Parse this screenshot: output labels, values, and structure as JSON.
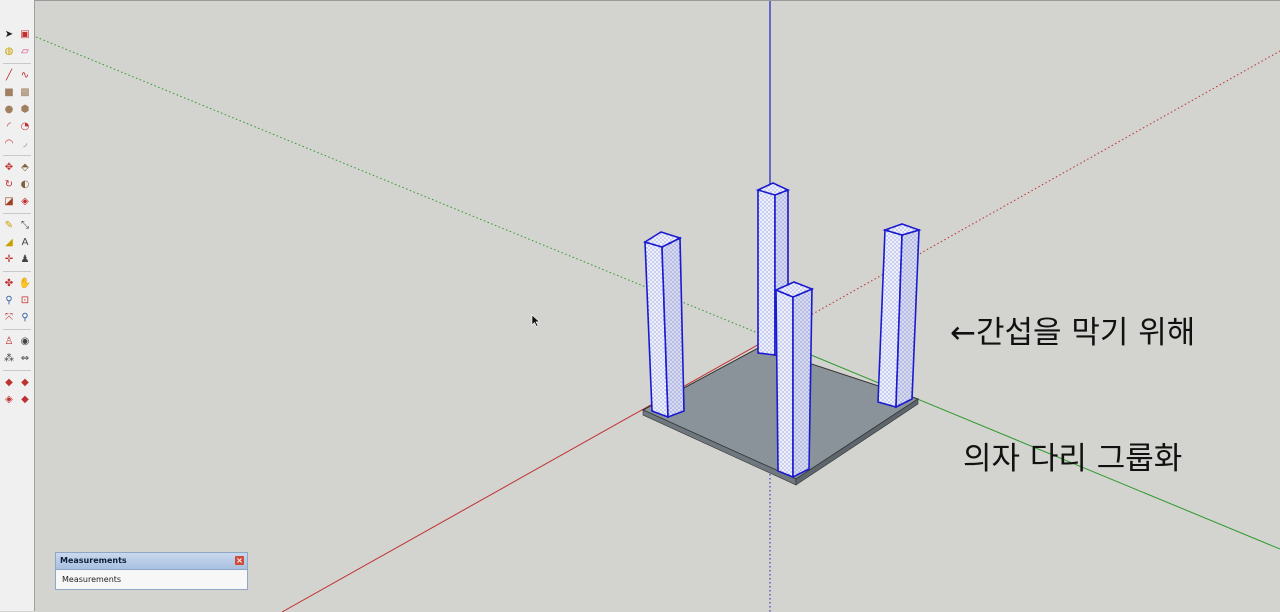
{
  "toolbar": {
    "groups": [
      {
        "tools": [
          {
            "icon": "select-arrow-icon",
            "glyph": "➤",
            "color": "#222"
          },
          {
            "icon": "make-component-icon",
            "glyph": "▣",
            "color": "#c03030"
          },
          {
            "icon": "paint-bucket-icon",
            "glyph": "◍",
            "color": "#c8a000"
          },
          {
            "icon": "eraser-icon",
            "glyph": "▱",
            "color": "#d04080"
          }
        ]
      },
      {
        "tools": [
          {
            "icon": "pencil-line-icon",
            "glyph": "╱",
            "color": "#b03020"
          },
          {
            "icon": "freehand-icon",
            "glyph": "∿",
            "color": "#c03030"
          },
          {
            "icon": "rectangle-icon",
            "glyph": "■",
            "color": "#a08060"
          },
          {
            "icon": "rotated-rectangle-icon",
            "glyph": "▩",
            "color": "#a08060"
          },
          {
            "icon": "circle-icon",
            "glyph": "●",
            "color": "#a08060"
          },
          {
            "icon": "polygon-icon",
            "glyph": "⬢",
            "color": "#a08060"
          },
          {
            "icon": "arc-icon",
            "glyph": "◜",
            "color": "#c03030"
          },
          {
            "icon": "pie-icon",
            "glyph": "◔",
            "color": "#c03030"
          },
          {
            "icon": "three-point-arc-icon",
            "glyph": "◠",
            "color": "#c03030"
          },
          {
            "icon": "two-point-arc-icon",
            "glyph": "◞",
            "color": "#a08060"
          }
        ]
      },
      {
        "tools": [
          {
            "icon": "move-icon",
            "glyph": "✥",
            "color": "#c03030"
          },
          {
            "icon": "push-pull-icon",
            "glyph": "⬘",
            "color": "#806040"
          },
          {
            "icon": "rotate-icon",
            "glyph": "↻",
            "color": "#c03030"
          },
          {
            "icon": "follow-me-icon",
            "glyph": "◐",
            "color": "#806040"
          },
          {
            "icon": "scale-icon",
            "glyph": "◪",
            "color": "#a04020"
          },
          {
            "icon": "offset-icon",
            "glyph": "◈",
            "color": "#c03030"
          }
        ]
      },
      {
        "tools": [
          {
            "icon": "tape-measure-icon",
            "glyph": "✎",
            "color": "#c8a000"
          },
          {
            "icon": "dimension-icon",
            "glyph": "⤡",
            "color": "#444"
          },
          {
            "icon": "protractor-icon",
            "glyph": "◢",
            "color": "#c8a000"
          },
          {
            "icon": "text-icon",
            "glyph": "A",
            "color": "#444"
          },
          {
            "icon": "axes-icon",
            "glyph": "✛",
            "color": "#c03030"
          },
          {
            "icon": "3d-text-icon",
            "glyph": "♟",
            "color": "#444"
          }
        ]
      },
      {
        "tools": [
          {
            "icon": "orbit-icon",
            "glyph": "✤",
            "color": "#c03030"
          },
          {
            "icon": "pan-hand-icon",
            "glyph": "✋",
            "color": "#c8a000"
          },
          {
            "icon": "zoom-icon",
            "glyph": "⚲",
            "color": "#3060a0"
          },
          {
            "icon": "zoom-window-icon",
            "glyph": "⊡",
            "color": "#c03030"
          },
          {
            "icon": "zoom-extents-icon",
            "glyph": "⤧",
            "color": "#c03030"
          },
          {
            "icon": "previous-view-icon",
            "glyph": "⚲",
            "color": "#3060a0"
          }
        ]
      },
      {
        "tools": [
          {
            "icon": "position-camera-icon",
            "glyph": "♙",
            "color": "#c03030"
          },
          {
            "icon": "look-around-icon",
            "glyph": "◉",
            "color": "#444"
          },
          {
            "icon": "walk-icon",
            "glyph": "⁂",
            "color": "#444"
          },
          {
            "icon": "section-plane-icon",
            "glyph": "⇔",
            "color": "#444"
          }
        ]
      },
      {
        "tools": [
          {
            "icon": "3d-warehouse-icon",
            "glyph": "◆",
            "color": "#c03030"
          },
          {
            "icon": "share-component-icon",
            "glyph": "◆",
            "color": "#c03030"
          },
          {
            "icon": "extension-warehouse-icon",
            "glyph": "◈",
            "color": "#c03030"
          },
          {
            "icon": "ruby-console-icon",
            "glyph": "◆",
            "color": "#c03030"
          }
        ]
      }
    ]
  },
  "annotation": {
    "line1": "←간섭을 막기 위해",
    "line2": "의자 다리 그룹화"
  },
  "measurements": {
    "title": "Measurements",
    "label": "Measurements",
    "close_glyph": "×"
  },
  "colors": {
    "background": "#d3d3cf",
    "axis_red": "#c03030",
    "axis_green": "#2c9a2c",
    "axis_blue": "#2020c8",
    "selection_blue": "#1a1ad0",
    "seat_gray": "#8a929a",
    "leg_face_light": "#eef0fa",
    "leg_face_dark": "#d6d9ec"
  }
}
